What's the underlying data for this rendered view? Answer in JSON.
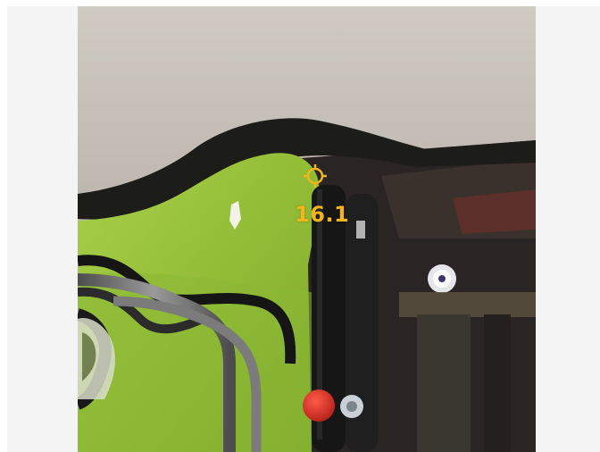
{
  "measurement": {
    "temperature": "16.1"
  },
  "overlay": {
    "crosshair_icon": "crosshair-target-icon",
    "accent_color": "#f2b51b"
  },
  "scene": {
    "background_color": "#f4f4f4",
    "primary_object_color": "#9bc33a"
  }
}
